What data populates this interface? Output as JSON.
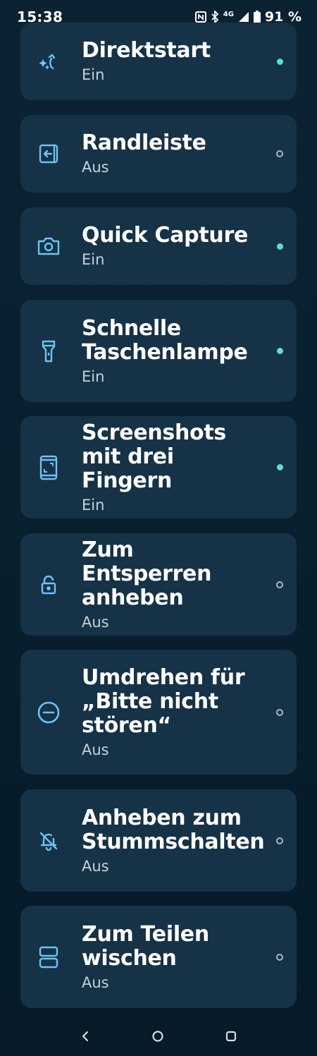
{
  "status_bar": {
    "time": "15:38",
    "network": "4G",
    "battery": "91 %"
  },
  "settings": [
    {
      "title": "Direktstart",
      "state": "Ein",
      "enabled": true,
      "icon": "sparkle-arrow-icon"
    },
    {
      "title": "Randleiste",
      "state": "Aus",
      "enabled": false,
      "icon": "edge-panel-icon"
    },
    {
      "title": "Quick Capture",
      "state": "Ein",
      "enabled": true,
      "icon": "camera-icon"
    },
    {
      "title": "Schnelle Taschenlampe",
      "state": "Ein",
      "enabled": true,
      "icon": "flashlight-icon"
    },
    {
      "title": "Screenshots mit drei Fingern",
      "state": "Ein",
      "enabled": true,
      "icon": "phone-screenshot-icon"
    },
    {
      "title": "Zum Entsperren anheben",
      "state": "Aus",
      "enabled": false,
      "icon": "unlock-icon"
    },
    {
      "title": "Umdrehen für „Bitte nicht stören“",
      "state": "Aus",
      "enabled": false,
      "icon": "do-not-disturb-icon"
    },
    {
      "title": "Anheben zum Stummschalten",
      "state": "Aus",
      "enabled": false,
      "icon": "bell-off-icon"
    },
    {
      "title": "Zum Teilen wischen",
      "state": "Aus",
      "enabled": false,
      "icon": "split-screen-icon"
    }
  ],
  "colors": {
    "accent": "#5fe0c2",
    "icon": "#6cc4f2",
    "card": "#163246",
    "background": "#0b2233"
  }
}
